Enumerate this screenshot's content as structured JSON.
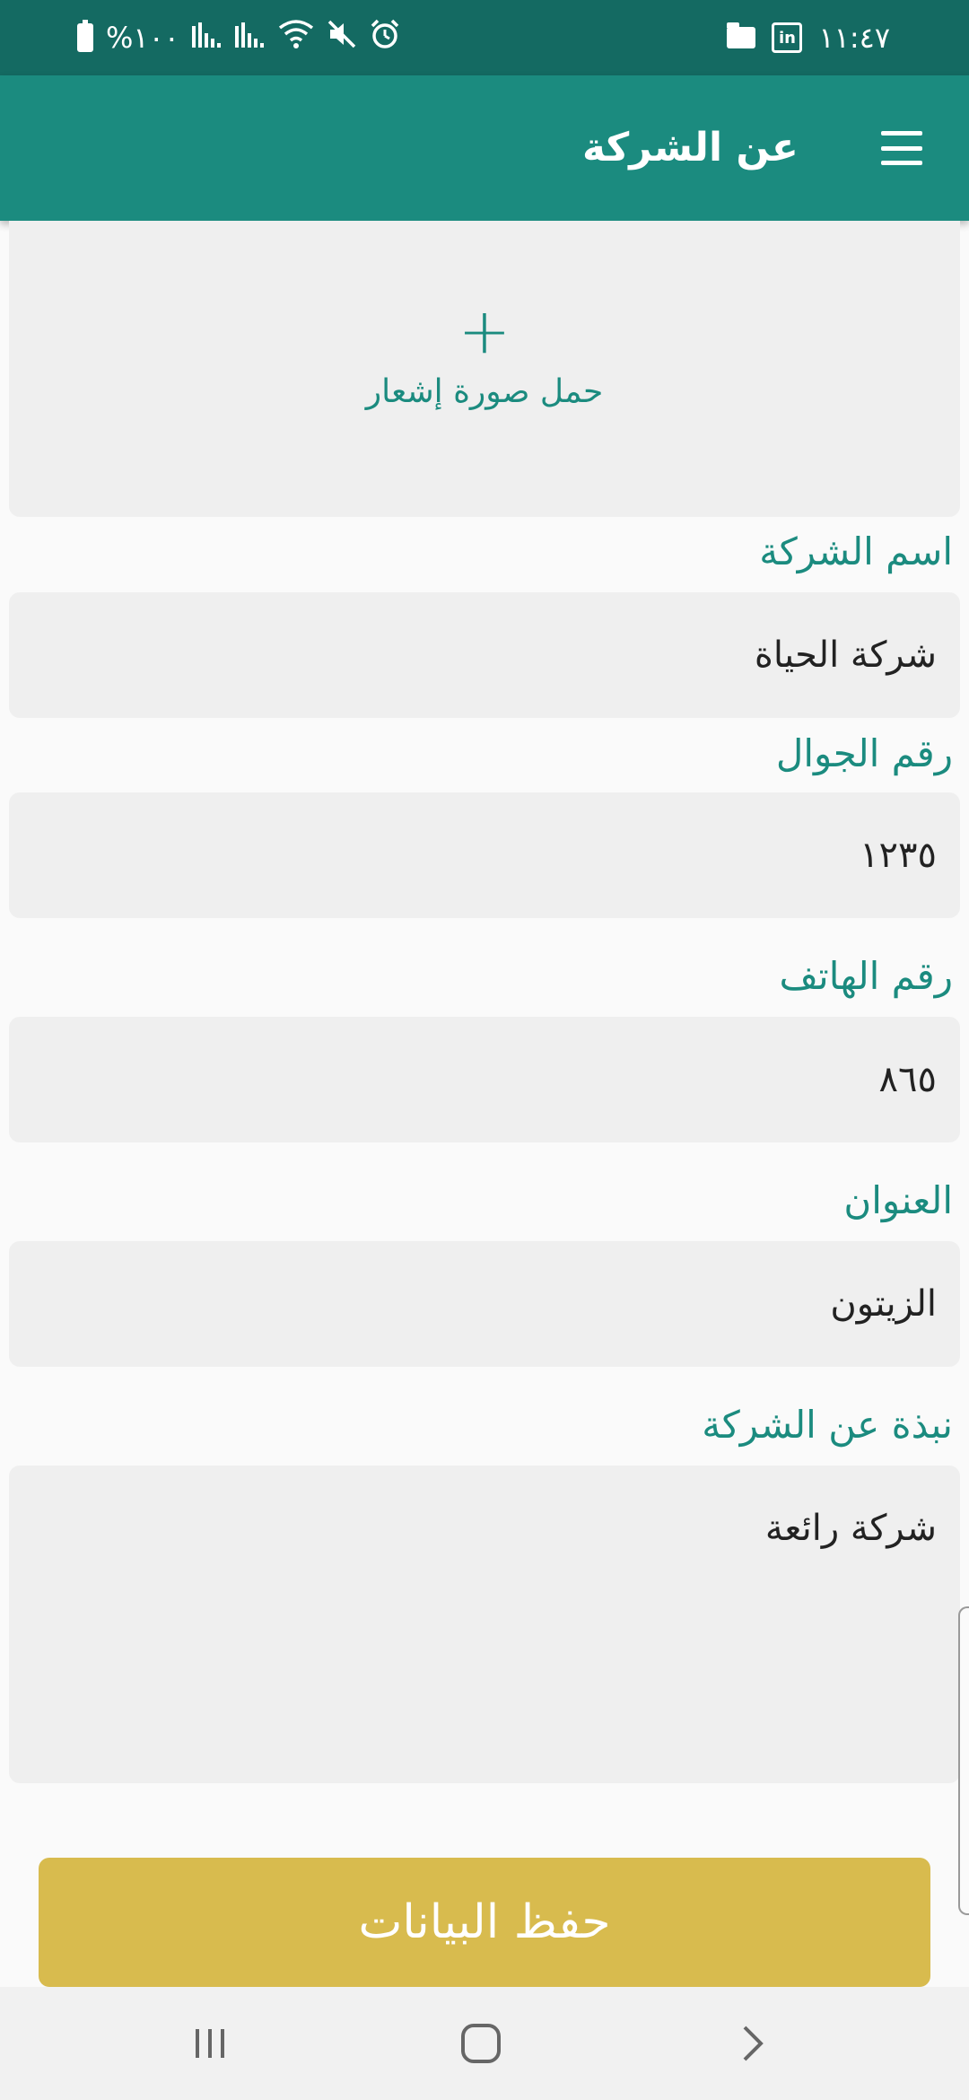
{
  "status_bar": {
    "time": "١١:٤٧",
    "battery_text": "%١٠٠",
    "icons": [
      "battery-icon",
      "signal-icon",
      "signal-icon",
      "wifi-icon",
      "mute-icon",
      "alarm-icon",
      "folder-icon",
      "linkedin-icon"
    ]
  },
  "app_bar": {
    "title": "عن الشركة",
    "menu_icon": "hamburger-menu-icon"
  },
  "upload": {
    "plus": "+",
    "label": "حمل صورة إشعار"
  },
  "form": {
    "company_name": {
      "label": "اسم الشركة",
      "value": "شركة الحياة"
    },
    "mobile": {
      "label": "رقم الجوال",
      "value": "١٢٣٥"
    },
    "phone": {
      "label": "رقم الهاتف",
      "value": "٨٦٥"
    },
    "address": {
      "label": "العنوان",
      "value": "الزيتون"
    },
    "about": {
      "label": "نبذة عن الشركة",
      "value": "شركة رائعة"
    }
  },
  "save_button": {
    "label": "حفظ البيانات"
  },
  "nav_bar": {
    "recents_icon": "recent-apps-icon",
    "home_icon": "home-icon",
    "back_icon": "back-icon"
  },
  "colors": {
    "status_bar": "#146a62",
    "app_bar": "#1b8b7f",
    "accent": "#1b8b7f",
    "field_bg": "#efefef",
    "save_button": "#d8bb4e"
  }
}
